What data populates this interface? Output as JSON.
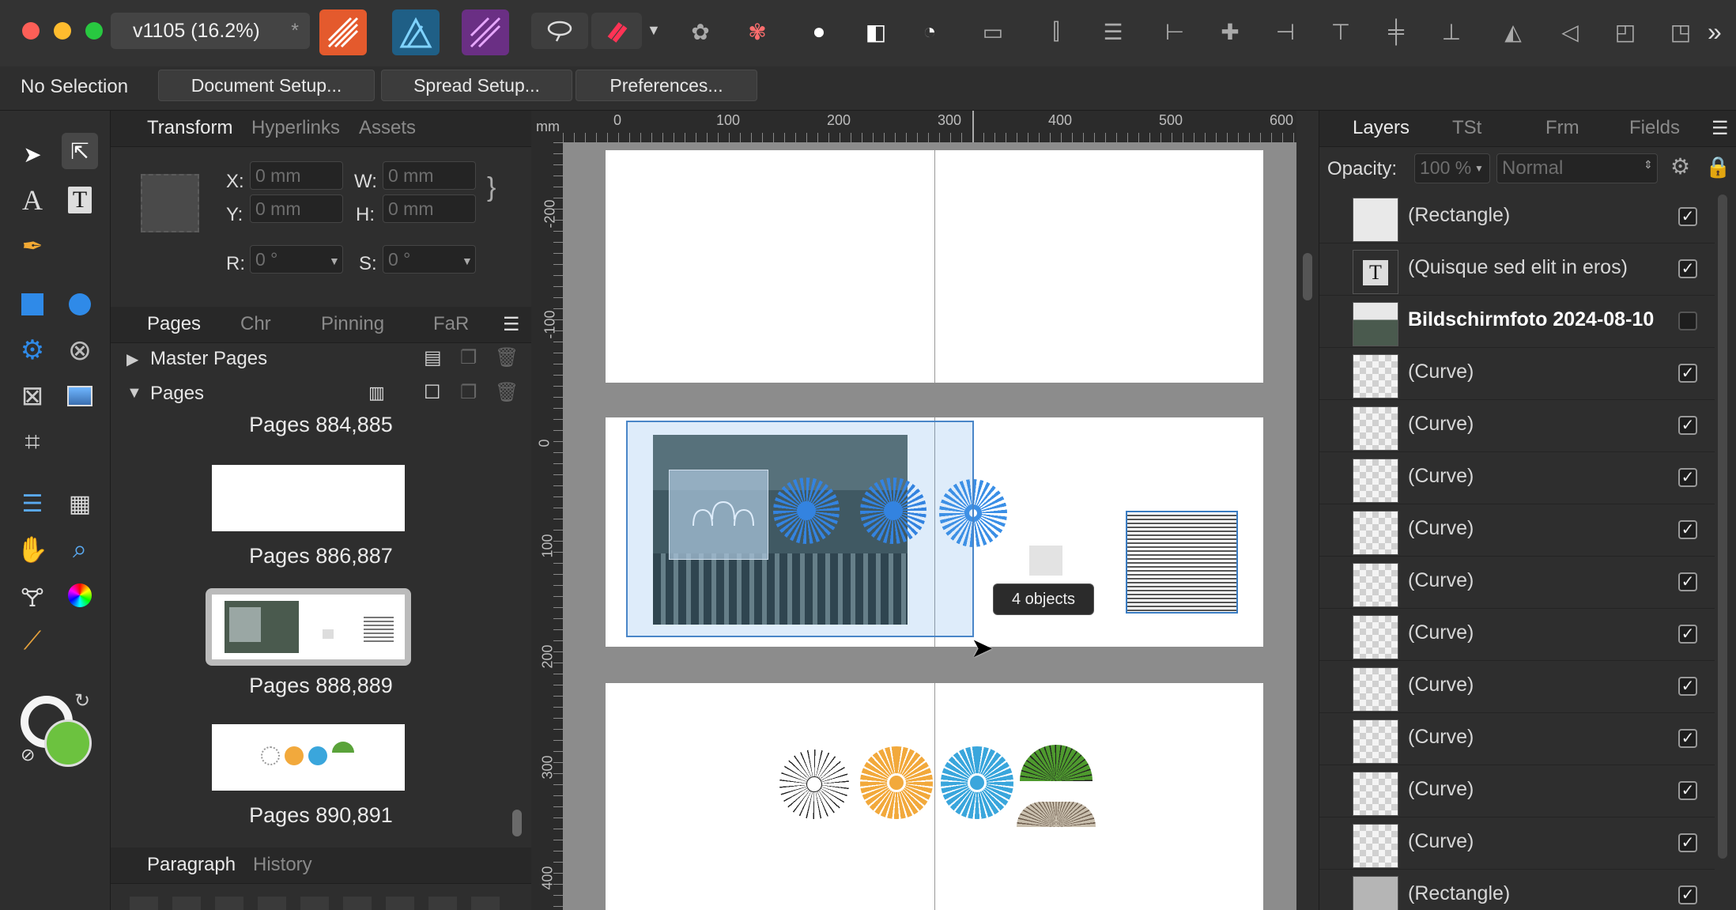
{
  "titlebar": {
    "doc_tab": "v1105  (16.2%)",
    "doc_tab_close": "*",
    "more": "»"
  },
  "context": {
    "selection": "No Selection",
    "buttons": [
      "Document Setup...",
      "Spread Setup...",
      "Preferences..."
    ]
  },
  "transform_panel": {
    "tabs": [
      "Transform",
      "Hyperlinks",
      "Assets"
    ],
    "x_label": "X:",
    "x_value": "0 mm",
    "y_label": "Y:",
    "y_value": "0 mm",
    "w_label": "W:",
    "w_value": "0 mm",
    "h_label": "H:",
    "h_value": "0 mm",
    "r_label": "R:",
    "r_value": "0 °",
    "s_label": "S:",
    "s_value": "0 °"
  },
  "pages_panel": {
    "tabs": [
      "Pages",
      "Chr",
      "Pinning",
      "FaR"
    ],
    "master_pages": "Master Pages",
    "pages": "Pages",
    "thumbs": [
      "Pages 884,885",
      "Pages 886,887",
      "Pages 888,889",
      "Pages 890,891"
    ]
  },
  "bottom_panel": {
    "tabs": [
      "Paragraph",
      "History"
    ]
  },
  "canvas": {
    "ruler_unit": "mm",
    "h_ticks": [
      "0",
      "100",
      "200",
      "300",
      "400",
      "500",
      "600"
    ],
    "v_ticks": [
      "-200",
      "-100",
      "0",
      "100",
      "200",
      "300",
      "400"
    ],
    "tooltip": "4 objects"
  },
  "layers_panel": {
    "tabs": [
      "Layers",
      "TSt",
      "Frm",
      "Fields"
    ],
    "opacity_label": "Opacity:",
    "opacity_value": "100 %",
    "blend_mode": "Normal",
    "layers": [
      {
        "name": "(Rectangle)",
        "checked": true,
        "thumb": "plain"
      },
      {
        "name": "(Quisque sed elit in eros)",
        "checked": true,
        "thumb": "text"
      },
      {
        "name": "Bildschirmfoto 2024-08-10",
        "checked": false,
        "thumb": "photo"
      },
      {
        "name": "(Curve)",
        "checked": true,
        "thumb": "checker"
      },
      {
        "name": "(Curve)",
        "checked": true,
        "thumb": "checker"
      },
      {
        "name": "(Curve)",
        "checked": true,
        "thumb": "checker"
      },
      {
        "name": "(Curve)",
        "checked": true,
        "thumb": "checker"
      },
      {
        "name": "(Curve)",
        "checked": true,
        "thumb": "checker"
      },
      {
        "name": "(Curve)",
        "checked": true,
        "thumb": "checker"
      },
      {
        "name": "(Curve)",
        "checked": true,
        "thumb": "checker"
      },
      {
        "name": "(Curve)",
        "checked": true,
        "thumb": "checker"
      },
      {
        "name": "(Curve)",
        "checked": true,
        "thumb": "checker"
      },
      {
        "name": "(Curve)",
        "checked": true,
        "thumb": "checker"
      },
      {
        "name": "(Rectangle)",
        "checked": true,
        "thumb": "gray"
      }
    ]
  }
}
